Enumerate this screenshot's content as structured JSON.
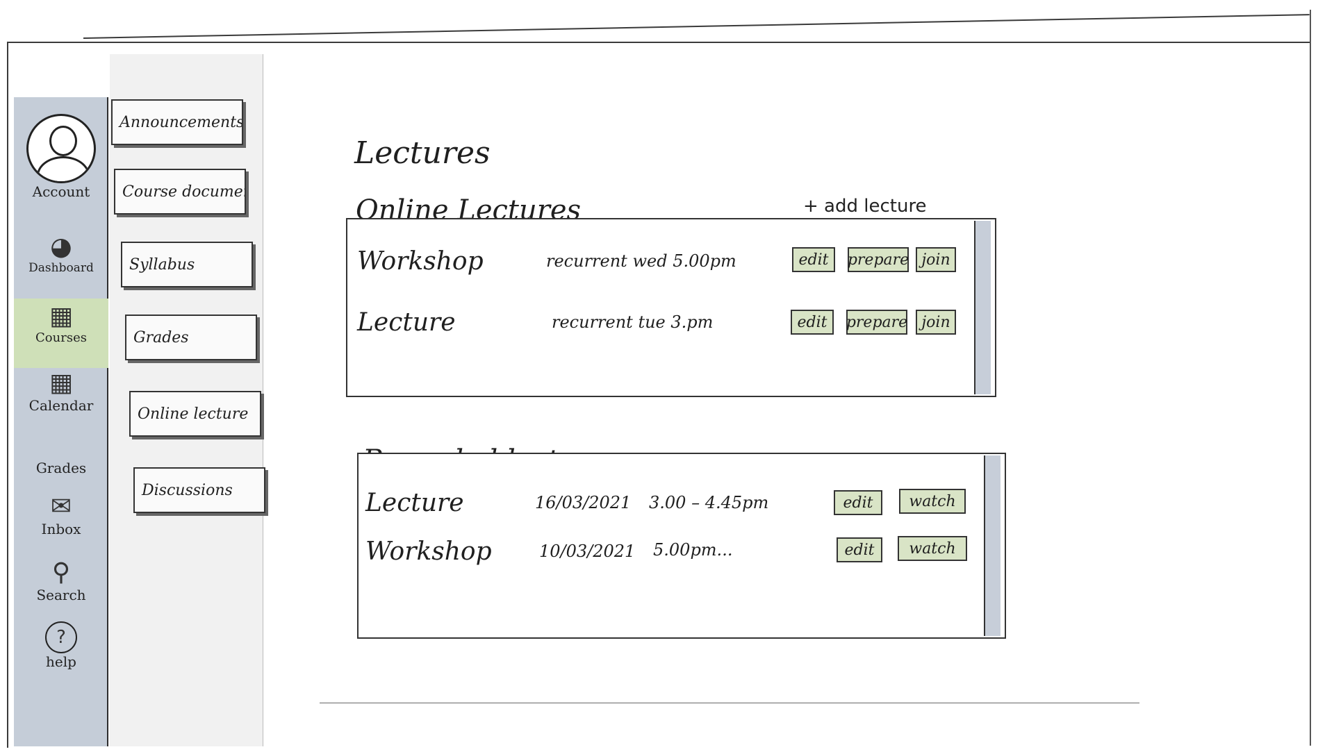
{
  "rail": {
    "items": [
      {
        "label": "Account",
        "icon": "avatar-icon"
      },
      {
        "label": "Dashboard",
        "icon": "speedometer-icon"
      },
      {
        "label": "Courses",
        "icon": "courses-icon"
      },
      {
        "label": "Calendar",
        "icon": "calendar-icon"
      },
      {
        "label": "Grades",
        "icon": "grades-icon"
      },
      {
        "label": "Inbox",
        "icon": "inbox-icon"
      },
      {
        "label": "Search",
        "icon": "search-icon"
      },
      {
        "label": "help",
        "icon": "help-icon"
      }
    ],
    "active_item": "Courses",
    "active_color": "#cfe0b8",
    "rail_color": "#c5cdd8"
  },
  "course_menu": {
    "items": [
      "Announcements",
      "Course documents",
      "Syllabus",
      "Grades",
      "Online lecture",
      "Discussions"
    ]
  },
  "main": {
    "title": "Lectures",
    "online": {
      "title": "Online Lectures",
      "add_label": "+ add lecture",
      "rows": [
        {
          "name": "Workshop",
          "schedule": "recurrent wed 5.00pm",
          "actions": [
            "edit",
            "prepare",
            "join"
          ]
        },
        {
          "name": "Lecture",
          "schedule": "recurrent tue 3.pm",
          "actions": [
            "edit",
            "prepare",
            "join"
          ]
        }
      ]
    },
    "recorded": {
      "title": "Recorded lectures",
      "rows": [
        {
          "name": "Lecture",
          "date": "16/03/2021",
          "time": "3.00 – 4.45pm",
          "actions": [
            "edit",
            "watch"
          ]
        },
        {
          "name": "Workshop",
          "date": "10/03/2021",
          "time": "5.00pm...",
          "actions": [
            "edit",
            "watch"
          ]
        }
      ]
    }
  },
  "colors": {
    "button_fill": "#d9e4c6",
    "scrollbar": "#c7ced9"
  }
}
